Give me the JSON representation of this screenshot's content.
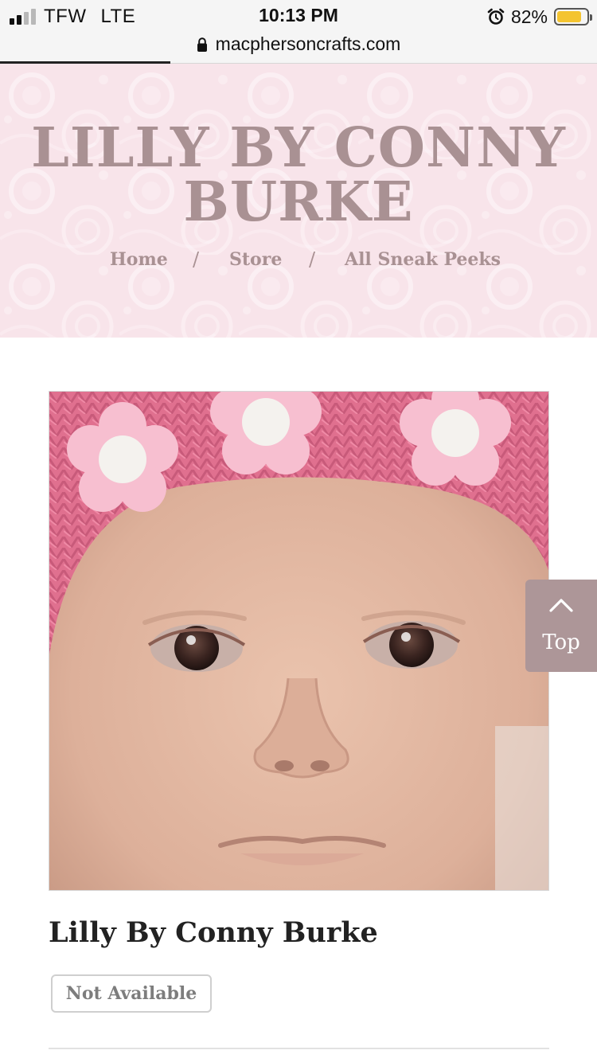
{
  "status_bar": {
    "carrier": "TFW",
    "network": "LTE",
    "time": "10:13 PM",
    "battery_percent": "82%",
    "battery_level": 0.82,
    "battery_color": "#f4c430",
    "signal_bars": 2,
    "signal_bars_total": 4,
    "icons": [
      "signal-icon",
      "alarm-icon",
      "battery-icon"
    ]
  },
  "browser": {
    "url": "macphersoncrafts.com",
    "load_progress": 0.285,
    "icons": [
      "lock-icon"
    ]
  },
  "header": {
    "site_title_line1": "LILLY BY CONNY",
    "site_title_line2": "BURKE",
    "breadcrumb": [
      {
        "label": "Home"
      },
      {
        "label": "Store"
      },
      {
        "label": "All Sneak Peeks"
      }
    ],
    "breadcrumb_separator": "/",
    "accent_color": "#a99193",
    "background_color": "#f9e4ea"
  },
  "product": {
    "title": "Lilly By Conny Burke",
    "availability_label": "Not Available"
  },
  "scroll_top": {
    "label": "Top",
    "icon": "chevron-up-icon",
    "background_color": "#ad9698"
  }
}
